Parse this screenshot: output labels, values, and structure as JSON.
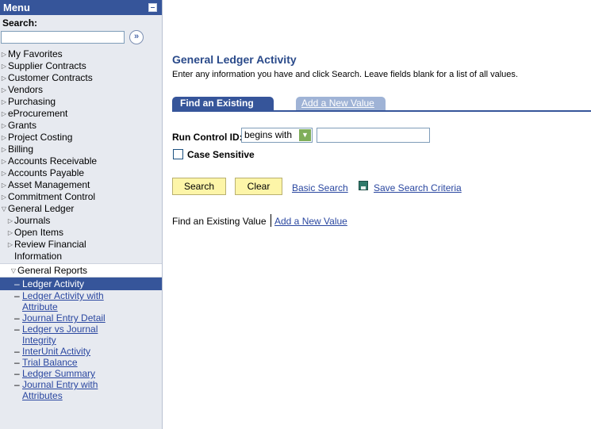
{
  "menu": {
    "title": "Menu",
    "search_label": "Search:",
    "search_value": "",
    "go_symbol": "»",
    "items": [
      {
        "label": "My Favorites"
      },
      {
        "label": "Supplier Contracts"
      },
      {
        "label": "Customer Contracts"
      },
      {
        "label": "Vendors"
      },
      {
        "label": "Purchasing"
      },
      {
        "label": "eProcurement"
      },
      {
        "label": "Grants"
      },
      {
        "label": "Project Costing"
      },
      {
        "label": "Billing"
      },
      {
        "label": "Accounts Receivable"
      },
      {
        "label": "Accounts Payable"
      },
      {
        "label": "Asset Management"
      },
      {
        "label": "Commitment Control"
      },
      {
        "label": "General Ledger"
      }
    ],
    "gl_children": [
      {
        "label": "Journals"
      },
      {
        "label": "Open Items"
      },
      {
        "label": "Review Financial"
      },
      {
        "label": "Information"
      }
    ],
    "general_reports": "General Reports",
    "reports": [
      {
        "label": "Ledger Activity"
      },
      {
        "label": "Ledger Activity with"
      },
      {
        "label": "Attribute"
      },
      {
        "label": "Journal Entry Detail"
      },
      {
        "label": "Ledger vs Journal"
      },
      {
        "label": "Integrity"
      },
      {
        "label": "InterUnit Activity"
      },
      {
        "label": "Trial Balance"
      },
      {
        "label": "Ledger Summary"
      },
      {
        "label": "Journal Entry with"
      },
      {
        "label": "Attributes"
      }
    ]
  },
  "main": {
    "title": "General Ledger Activity",
    "instructions": "Enter any information you have and click Search. Leave fields blank for a list of all values.",
    "tabs": [
      {
        "label": "Find an Existing Value"
      },
      {
        "label": "Add a New Value"
      }
    ],
    "run_control_label": "Run Control ID:",
    "operator_value": "begins with",
    "run_control_value": "",
    "case_sensitive_label": "Case Sensitive",
    "search_button": "Search",
    "clear_button": "Clear",
    "basic_search_link": "Basic Search",
    "save_criteria_link": "Save Search Criteria",
    "bottom_find": "Find an Existing Value",
    "bottom_add": "Add a New Value"
  },
  "colors": {
    "menu_header": "#36559a",
    "button_bg": "#fdf5a8",
    "link": "#2a47a0",
    "title": "#2a4a8a"
  },
  "icons": [
    "collapse-icon",
    "go-arrow-icon",
    "expand-triangle-icon",
    "dropdown-arrow-icon",
    "save-disk-icon"
  ]
}
